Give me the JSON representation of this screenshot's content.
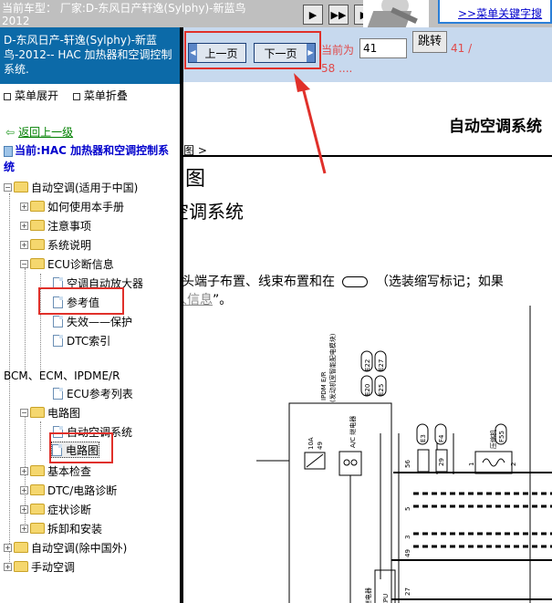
{
  "topbar": {
    "vehicle_line1": "当前车型： 厂家:D-东风日产轩逸(Sylphy)-新蓝鸟",
    "vehicle_line2": "2012",
    "nav_buttons": [
      "▶",
      "▶▶",
      "▶"
    ],
    "keyword_link": ">>菜单关键字搜"
  },
  "left_panel": {
    "doc_title": "D-东风日产-轩逸(Sylphy)-新蓝鸟-2012-- HAC 加热器和空调控制系统.",
    "expand_label": "菜单展开",
    "collapse_label": "菜单折叠",
    "back_label": "返回上一级",
    "current_label": "当前:HAC 加热器和空调控制系统",
    "tree": [
      {
        "label": "自动空调(适用于中国)"
      },
      {
        "label": "如何使用本手册"
      },
      {
        "label": "注意事项"
      },
      {
        "label": "系统说明"
      },
      {
        "label": "ECU诊断信息"
      },
      {
        "label": "空调自动放大器"
      },
      {
        "label": "参考值"
      },
      {
        "label": "失效——保护"
      },
      {
        "label": "DTC索引"
      },
      {
        "label": "BCM、ECM、IPDME/R"
      },
      {
        "label": "ECU参考列表"
      },
      {
        "label": "电路图"
      },
      {
        "label": "自动空调系统"
      },
      {
        "label": "电路图"
      },
      {
        "label": "基本检查"
      },
      {
        "label": "DTC/电路诊断"
      },
      {
        "label": "症状诊断"
      },
      {
        "label": "拆卸和安装"
      },
      {
        "label": "自动空调(除中国外)"
      },
      {
        "label": "手动空调"
      }
    ]
  },
  "page_toolbar": {
    "prev_label": "上一页",
    "next_label": "下一页",
    "current_page_label": "当前为",
    "page_value": "41",
    "jump_label": "跳转",
    "page_counter": "41 /",
    "page_counter_2": "58 ...."
  },
  "content": {
    "title": "自动空调系统",
    "crumb": "图 >",
    "section_heading": "图",
    "sub_heading": "空调系统",
    "note_line1": "头端子布置、线束布置和在",
    "note_line1_rest": "（选装缩写标记；如果",
    "note_line2_link": "人信息",
    "note_line2_rest": "”。"
  },
  "diagram": {
    "ipdm_label": "IPDM E/R",
    "ipdm_sub": "(发动机室智能配电模块)",
    "connectors": [
      "E22",
      "E27",
      "E20",
      "E25",
      "E3",
      "F4",
      "F55"
    ],
    "relay_label": "A/C 继电器",
    "fuse_label": "10A",
    "fuse_num": "49",
    "compressor_label": "压缩机",
    "pins": [
      "56",
      "29",
      "1",
      "2",
      "5",
      "3",
      "49",
      "27"
    ],
    "cpu_label": "CPU",
    "lower_label": "继电器"
  }
}
